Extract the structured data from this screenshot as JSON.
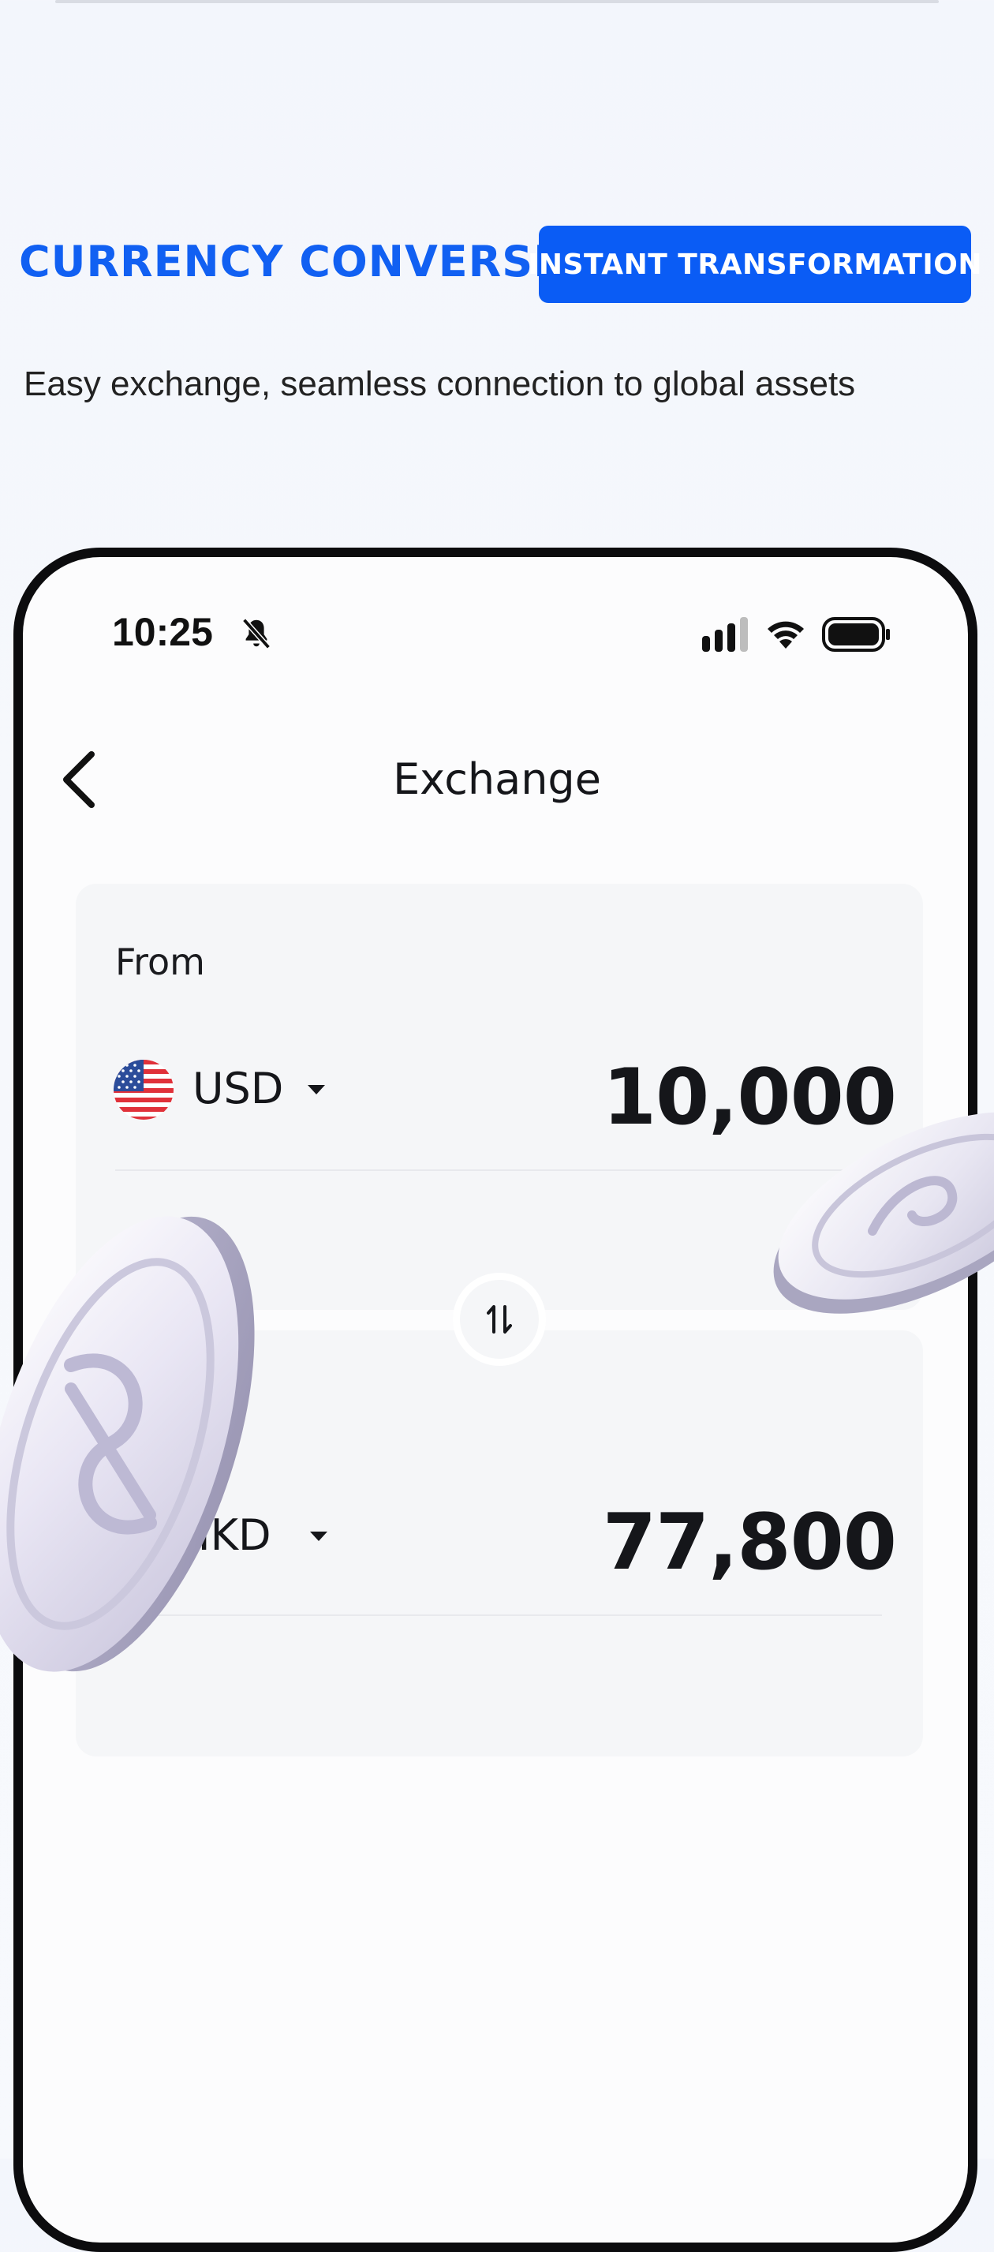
{
  "header": {
    "headline": "CURRENCY CONVERSION",
    "badge": "INSTANT TRANSFORMATION",
    "subtitle": "Easy exchange, seamless connection to global assets"
  },
  "status_bar": {
    "time": "10:25"
  },
  "nav": {
    "title": "Exchange"
  },
  "from": {
    "label": "From",
    "currency": "USD",
    "amount": "10,000"
  },
  "to": {
    "currency": "HKD",
    "amount": "77,800"
  },
  "colors": {
    "accent": "#0a5cf5",
    "headline": "#1160f2",
    "card_bg": "#f5f6f8"
  },
  "icons": [
    "bell-muted-icon",
    "signal-icon",
    "wifi-icon",
    "battery-icon",
    "back-chevron-icon",
    "swap-icon",
    "caret-down-icon",
    "us-flag-icon",
    "coin-icon"
  ]
}
